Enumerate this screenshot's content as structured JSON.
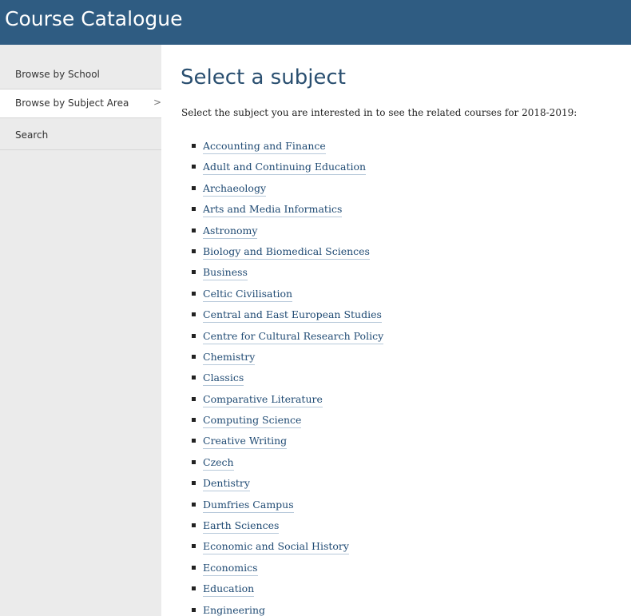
{
  "header": {
    "title": "Course Catalogue"
  },
  "sidebar": {
    "items": [
      {
        "label": "Browse by School",
        "active": false
      },
      {
        "label": "Browse by Subject Area",
        "active": true,
        "chevron": ">"
      },
      {
        "label": "Search",
        "active": false
      }
    ]
  },
  "main": {
    "title": "Select a subject",
    "intro": "Select the subject you are interested in to see the related courses for 2018-2019:",
    "subjects": [
      "Accounting and Finance",
      "Adult and Continuing Education",
      "Archaeology",
      "Arts and Media Informatics",
      "Astronomy",
      "Biology and Biomedical Sciences",
      "Business",
      "Celtic Civilisation",
      "Central and East European Studies",
      "Centre for Cultural Research Policy",
      "Chemistry",
      "Classics",
      "Comparative Literature",
      "Computing Science",
      "Creative Writing",
      "Czech",
      "Dentistry",
      "Dumfries Campus",
      "Earth Sciences",
      "Economic and Social History",
      "Economics",
      "Education",
      "Engineering"
    ]
  },
  "colors": {
    "header_bg": "#2f5c82",
    "sidebar_bg": "#ebebeb",
    "link": "#1f4a73",
    "title": "#2a4f70"
  }
}
